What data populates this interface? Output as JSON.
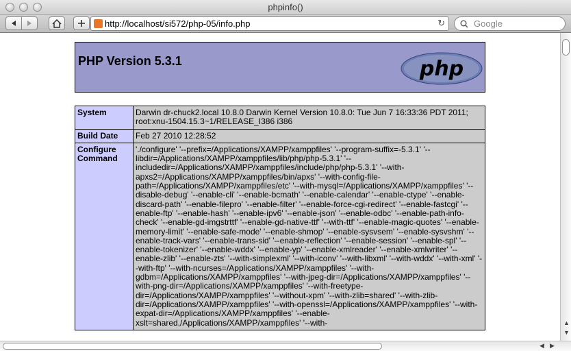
{
  "window": {
    "title": "phpinfo()"
  },
  "toolbar": {
    "url": "http://localhost/si572/php-05/info.php",
    "search_placeholder": "Google"
  },
  "header": {
    "version_text": "PHP Version 5.3.1",
    "logo_text": "php"
  },
  "rows": [
    {
      "label": "System",
      "value": "Darwin dr-chuck2.local 10.8.0 Darwin Kernel Version 10.8.0: Tue Jun 7 16:33:36 PDT 2011; root:xnu-1504.15.3~1/RELEASE_I386 i386"
    },
    {
      "label": "Build Date",
      "value": "Feb 27 2010 12:28:52"
    },
    {
      "label": "Configure Command",
      "value": "'./configure' '--prefix=/Applications/XAMPP/xamppfiles' '--program-suffix=-5.3.1' '--libdir=/Applications/XAMPP/xamppfiles/lib/php/php-5.3.1' '--includedir=/Applications/XAMPP/xamppfiles/include/php/php-5.3.1' '--with-apxs2=/Applications/XAMPP/xamppfiles/bin/apxs' '--with-config-file-path=/Applications/XAMPP/xamppfiles/etc' '--with-mysql=/Applications/XAMPP/xamppfiles' '--disable-debug' '--enable-cli' '--enable-bcmath' '--enable-calendar' '--enable-ctype' '--enable-discard-path' '--enable-filepro' '--enable-filter' '--enable-force-cgi-redirect' '--enable-fastcgi' '--enable-ftp' '--enable-hash' '--enable-ipv6' '--enable-json' '--enable-odbc' '--enable-path-info-check' '--enable-gd-imgstrttf' '--enable-gd-native-ttf' '--with-ttf' '--enable-magic-quotes' '--enable-memory-limit' '--enable-safe-mode' '--enable-shmop' '--enable-sysvsem' '--enable-sysvshm' '--enable-track-vars' '--enable-trans-sid' '--enable-reflection' '--enable-session' '--enable-spl' '--enable-tokenizer' '--enable-wddx' '--enable-yp' '--enable-xmlreader' '--enable-xmlwriter' '--enable-zlib' '--enable-zts' '--with-simplexml' '--with-iconv' '--with-libxml' '--with-wddx' '--with-xml' '--with-ftp' '--with-ncurses=/Applications/XAMPP/xamppfiles' '--with-gdbm=/Applications/XAMPP/xamppfiles' '--with-jpeg-dir=/Applications/XAMPP/xamppfiles' '--with-png-dir=/Applications/XAMPP/xamppfiles' '--with-freetype-dir=/Applications/XAMPP/xamppfiles' '--without-xpm' '--with-zlib=shared' '--with-zlib-dir=/Applications/XAMPP/xamppfiles' '--with-openssl=/Applications/XAMPP/xamppfiles' '--with-expat-dir=/Applications/XAMPP/xamppfiles' '--enable-xslt=shared,/Applications/XAMPP/xamppfiles' '--with-"
    }
  ],
  "colors": {
    "header_bg": "#9999cc",
    "label_bg": "#ccccff",
    "value_bg": "#cccccc"
  }
}
